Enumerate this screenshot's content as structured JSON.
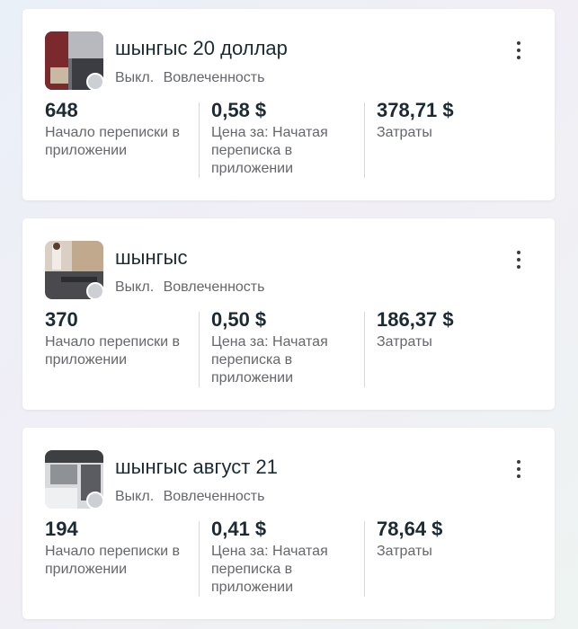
{
  "campaigns": [
    {
      "title": "шынгыс 20 доллар",
      "status": "Выкл.",
      "objective": "Вовлеченность",
      "thumbnail_icon": "ad-thumbnail-image",
      "metrics": [
        {
          "value": "648",
          "label": "Начало переписки в приложении"
        },
        {
          "value": "0,58 $",
          "label": "Цена за: Начатая переписка в приложении"
        },
        {
          "value": "378,71 $",
          "label": "Затраты"
        }
      ]
    },
    {
      "title": "шынгыс",
      "status": "Выкл.",
      "objective": "Вовлеченность",
      "thumbnail_icon": "ad-thumbnail-image",
      "metrics": [
        {
          "value": "370",
          "label": "Начало переписки в приложении"
        },
        {
          "value": "0,50 $",
          "label": "Цена за: Начатая переписка в приложении"
        },
        {
          "value": "186,37 $",
          "label": "Затраты"
        }
      ]
    },
    {
      "title": "шынгыс август 21",
      "status": "Выкл.",
      "objective": "Вовлеченность",
      "thumbnail_icon": "ad-thumbnail-image",
      "metrics": [
        {
          "value": "194",
          "label": "Начало переписки в приложении"
        },
        {
          "value": "0,41 $",
          "label": "Цена за: Начатая переписка в приложении"
        },
        {
          "value": "78,64 $",
          "label": "Затраты"
        }
      ]
    }
  ],
  "colors": {
    "status_off_dot": "#ccd0d5",
    "text_primary": "#1c2b33",
    "text_secondary": "#65676b"
  }
}
